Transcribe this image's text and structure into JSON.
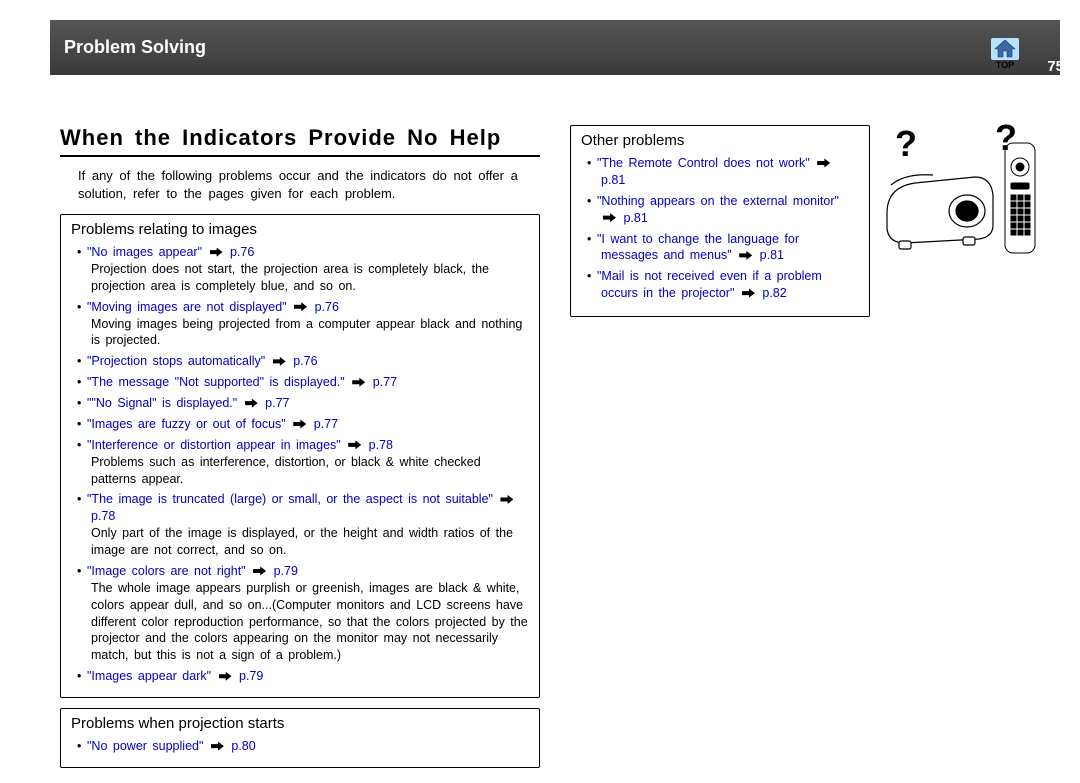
{
  "header": {
    "breadcrumb": "Problem Solving",
    "page": "75",
    "top_label": "TOP"
  },
  "title": "When the Indicators Provide No Help",
  "intro": "If any of the following problems occur and the indicators do not offer a solution, refer to the pages given for each problem.",
  "images_section": {
    "heading": "Problems relating to images",
    "items": [
      {
        "link": "\"No images appear\"",
        "page": "p.76",
        "desc": "Projection does not start, the projection area is completely black, the projection area is completely blue, and so on."
      },
      {
        "link": "\"Moving images are not displayed\"",
        "page": "p.76",
        "desc": "Moving images being projected from a computer appear black and nothing is projected."
      },
      {
        "link": "\"Projection stops automatically\"",
        "page": "p.76"
      },
      {
        "link": "\"The message \"Not supported\" is displayed.\"",
        "page": "p.77"
      },
      {
        "link": "\"\"No Signal\" is displayed.\"",
        "page": "p.77"
      },
      {
        "link": "\"Images are fuzzy or out of focus\"",
        "page": "p.77"
      },
      {
        "link": "\"Interference or distortion appear in images\"",
        "page": "p.78",
        "desc": "Problems such as interference, distortion, or black & white checked patterns appear."
      },
      {
        "link": "\"The image is truncated (large) or small, or the aspect is not suitable\"",
        "page": "p.78",
        "desc": "Only part of the image is displayed, or the height and width ratios of the image are not correct, and so on."
      },
      {
        "link": "\"Image colors are not right\"",
        "page": "p.79",
        "desc": "The whole image appears purplish or greenish, images are black & white, colors appear dull, and so on...(Computer monitors and LCD screens have different color reproduction performance, so that the colors projected by the projector and the colors appearing on the monitor may not necessarily match, but this is not a sign of a problem.)"
      },
      {
        "link": "\"Images appear dark\"",
        "page": "p.79"
      }
    ]
  },
  "start_section": {
    "heading": "Problems when projection starts",
    "items": [
      {
        "link": "\"No power supplied\"",
        "page": "p.80"
      }
    ]
  },
  "other_section": {
    "heading": "Other problems",
    "items": [
      {
        "link": "\"The Remote Control does not work\"",
        "page": "p.81"
      },
      {
        "link": "\"Nothing appears on the external monitor\"",
        "page": "p.81"
      },
      {
        "link": "\"I want to change the language for messages and menus\"",
        "page": "p.81"
      },
      {
        "link": "\"Mail is not received even if a problem occurs in the projector\"",
        "page": "p.82"
      }
    ]
  }
}
